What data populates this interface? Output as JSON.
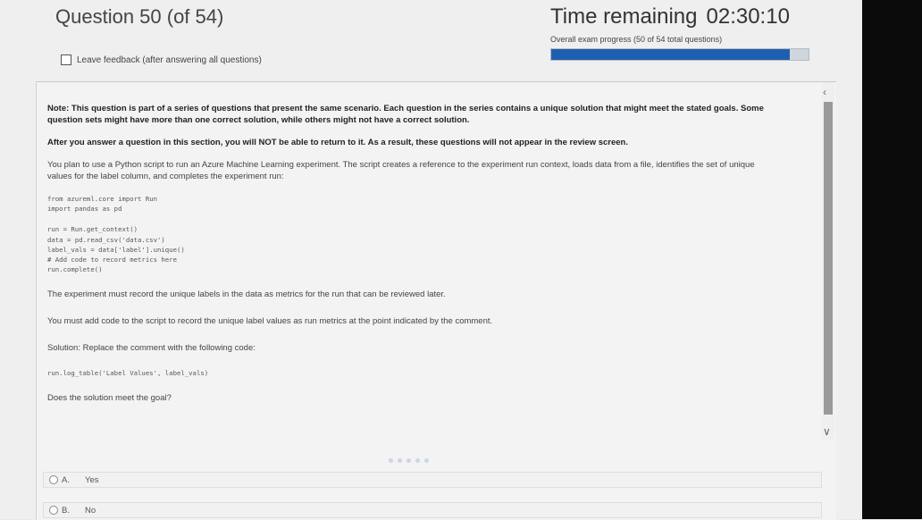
{
  "header": {
    "question_title": "Question 50 (of 54)",
    "time_label": "Time remaining",
    "time_value": "02:30:10",
    "progress_label": "Overall exam progress (50 of 54 total questions)",
    "progress_fraction": 0.926,
    "feedback_label": "Leave feedback (after answering all questions)"
  },
  "question": {
    "note": "Note: This question is part of a series of questions that present the same scenario. Each question in the series contains a unique solution that might meet the stated goals. Some question sets might have more than one correct solution, while others might not have a correct solution.",
    "warning": "After you answer a question in this section, you will NOT be able to return to it. As a result, these questions will not appear in the review screen.",
    "scenario": "You plan to use a Python script to run an Azure Machine Learning experiment. The script creates a reference to the experiment run context, loads data from a file, identifies the set of unique values for the label column, and completes the experiment run:",
    "code_imports": [
      "from azureml.core import Run",
      "import pandas as pd"
    ],
    "code_body": [
      "run = Run.get_context()",
      "data = pd.read_csv('data.csv')",
      "label_vals = data['label'].unique()",
      "# Add code to record metrics here",
      "run.complete()"
    ],
    "requirement": "The experiment must record the unique labels in the data as metrics for the run that can be reviewed later.",
    "task": "You must add code to the script to record the unique label values as run metrics at the point indicated by the comment.",
    "solution_label": "Solution: Replace the comment with the following code:",
    "solution_code": "run.log_table('Label Values', label_vals)",
    "question_text": "Does the solution meet the goal?"
  },
  "options": [
    {
      "letter": "A.",
      "text": "Yes"
    },
    {
      "letter": "B.",
      "text": "No"
    }
  ],
  "colors": {
    "progress_fill": "#1f5fb0",
    "accent": "#1f5fb0"
  }
}
